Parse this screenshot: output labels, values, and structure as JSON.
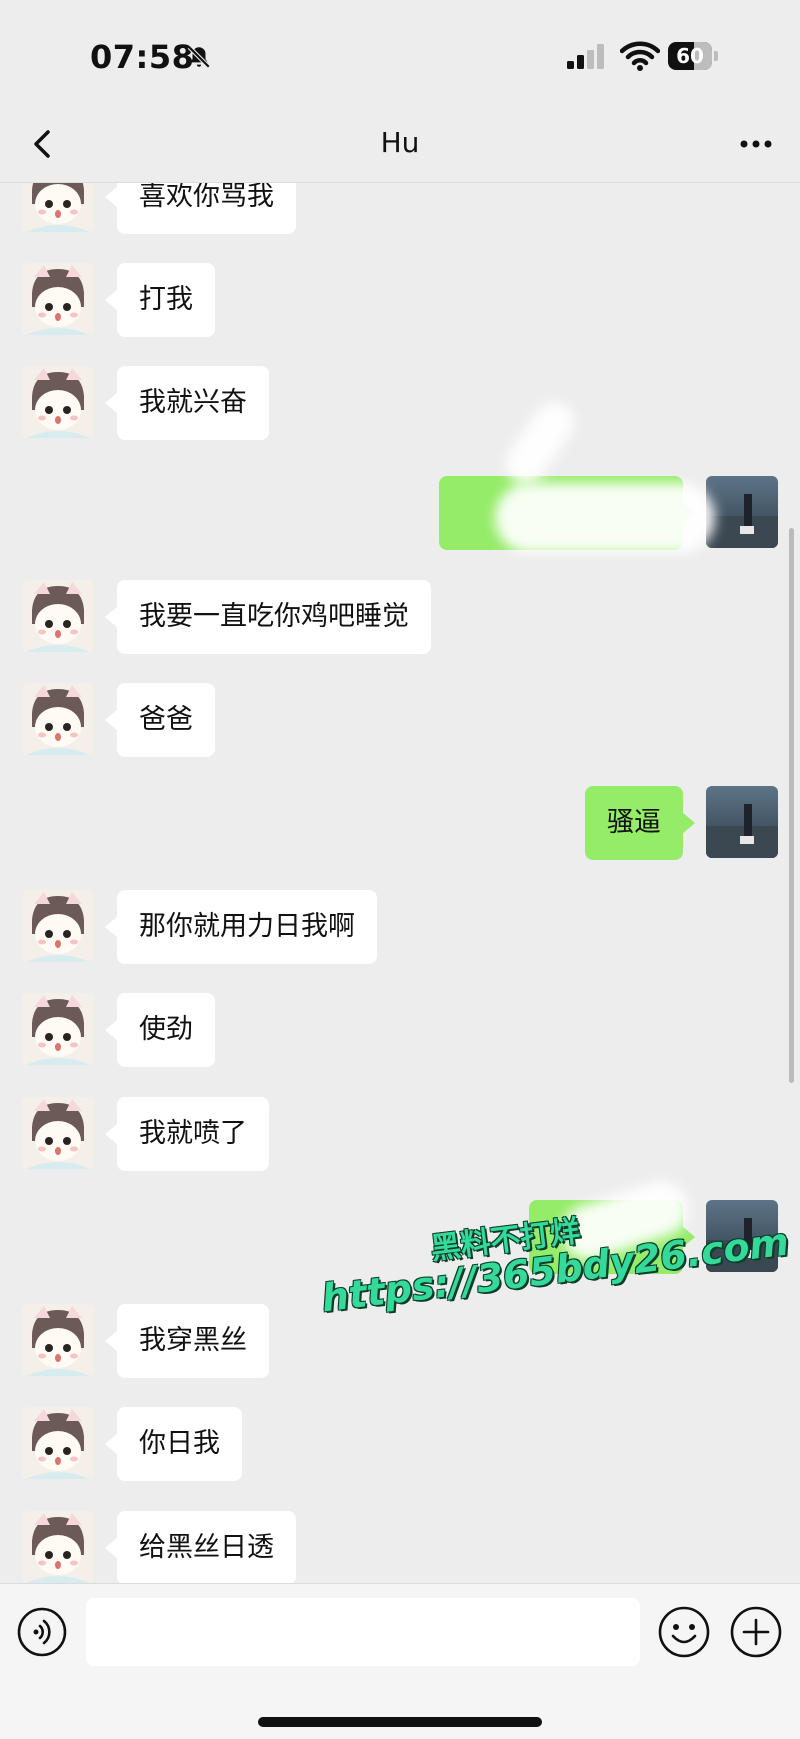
{
  "status_bar": {
    "time": "07:58",
    "battery": "60",
    "battery_level": 0.6
  },
  "header": {
    "title": "Hu"
  },
  "messages": [
    {
      "side": "left",
      "text": "喜欢你骂我"
    },
    {
      "side": "left",
      "text": "打我"
    },
    {
      "side": "left",
      "text": "我就兴奋"
    },
    {
      "side": "right",
      "text": ""
    },
    {
      "side": "left",
      "text": "我要一直吃你鸡吧睡觉"
    },
    {
      "side": "left",
      "text": "爸爸"
    },
    {
      "side": "right",
      "text": "骚逼"
    },
    {
      "side": "left",
      "text": "那你就用力日我啊"
    },
    {
      "side": "left",
      "text": "使劲"
    },
    {
      "side": "left",
      "text": "我就喷了"
    },
    {
      "side": "right",
      "text": ""
    },
    {
      "side": "left",
      "text": "我穿黑丝"
    },
    {
      "side": "left",
      "text": "你日我"
    },
    {
      "side": "left",
      "text": "给黑丝日透"
    }
  ],
  "watermark": {
    "line1": "黑料不打烊",
    "line2": "https://365bdy26.com"
  },
  "input": {
    "value": ""
  },
  "colors": {
    "background": "#ededed",
    "bubble_self": "#95ec69",
    "bubble_other": "#ffffff",
    "watermark": "#35d99a"
  },
  "icons": {
    "back": "chevron-left-icon",
    "more": "more-dots-icon",
    "mute": "bell-slash-icon",
    "voice": "voice-icon",
    "emoji": "emoji-icon",
    "plus": "plus-icon"
  }
}
